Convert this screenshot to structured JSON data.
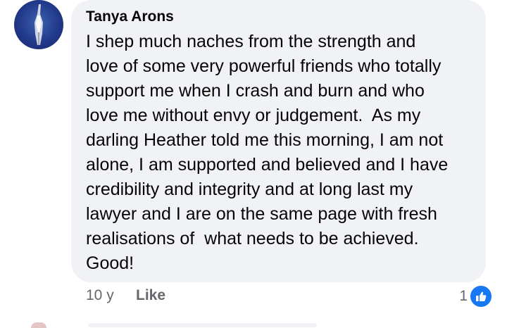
{
  "comment": {
    "avatar_icon": "user-avatar-icon",
    "author": "Tanya Arons",
    "lines": [
      "I shep much naches from the strength and",
      "love of some very powerful friends who totally",
      "support me when I crash and burn and who",
      "love me without envy or judgement.  As my",
      "darling Heather told me this morning, I am not",
      "alone, I am supported and believed and I have",
      "credibility and integrity and at long last my",
      "lawyer and I are on the same page with fresh",
      "realisations of  what needs to be achieved.",
      "Good!"
    ],
    "timestamp": "10 y",
    "like_label": "Like",
    "reaction_count": "1",
    "reaction_icon": "thumbs-up-icon"
  },
  "colors": {
    "bubble_bg": "#f0f2f5",
    "meta_text": "#65676b",
    "like_blue": "#1877f2",
    "text": "#050505"
  }
}
